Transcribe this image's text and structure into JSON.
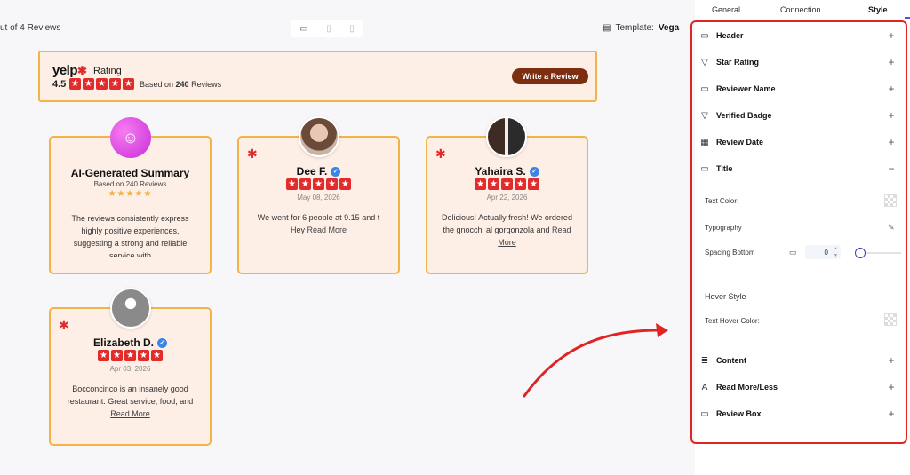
{
  "topbar": {
    "count_text": "ut of 4 Reviews",
    "template_label": "Template:",
    "template_value": "Vega"
  },
  "banner": {
    "logo_text": "yelp",
    "rating_label": "Rating",
    "score": "4.5",
    "based_prefix": "Based on",
    "based_count": "240",
    "based_suffix": "Reviews",
    "write_button": "Write a Review"
  },
  "ai_card": {
    "title": "AI-Generated Summary",
    "based": "Based on 240 Reviews",
    "stars": "★★★★★",
    "body": "The reviews consistently express highly positive experiences, suggesting a strong and reliable service with"
  },
  "reviews": [
    {
      "name": "Dee F.",
      "date": "May 08, 2026",
      "body": "We went for 6 people at 9.15 and t Hey",
      "more": "Read More"
    },
    {
      "name": "Yahaira S.",
      "date": "Apr 22, 2026",
      "body": "Delicious! Actually fresh! We ordered the gnocchi al gorgonzola and",
      "more": "Read More"
    },
    {
      "name": "Elizabeth D.",
      "date": "Apr 03, 2026",
      "body": "Bocconcinco is an insanely good restaurant. Great service, food, and",
      "more": "Read More"
    }
  ],
  "panel": {
    "tabs": [
      "General",
      "Connection",
      "Style"
    ],
    "sections": {
      "header": "Header",
      "star_rating": "Star Rating",
      "reviewer_name": "Reviewer Name",
      "verified_badge": "Verified Badge",
      "review_date": "Review Date",
      "title": "Title",
      "content": "Content",
      "read_more": "Read More/Less",
      "review_box": "Review Box"
    },
    "controls": {
      "text_color": "Text Color:",
      "typography": "Typography",
      "spacing_bottom": "Spacing Bottom",
      "spacing_value": "0",
      "hover_style": "Hover Style",
      "text_hover_color": "Text Hover Color:"
    }
  },
  "colors": {
    "accent_red": "#e02424",
    "card_border": "#f2b448",
    "card_bg": "#fdeee6",
    "button_brown": "#7d2d10",
    "verify_blue": "#3a86e8"
  }
}
